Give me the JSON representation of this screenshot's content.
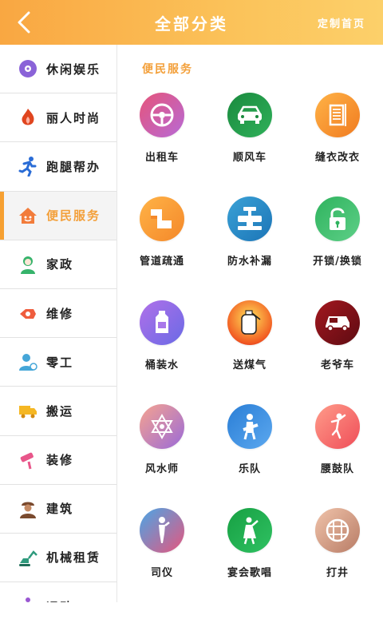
{
  "header": {
    "title": "全部分类",
    "right_link": "定制首页"
  },
  "sidebar": {
    "items": [
      {
        "label": "休闲娱乐",
        "icon": "music-disc-icon",
        "color": "#7b5bd6"
      },
      {
        "label": "丽人时尚",
        "icon": "flame-icon",
        "color": "#e0451f"
      },
      {
        "label": "跑腿帮办",
        "icon": "runner-icon",
        "color": "#2a6cd6"
      },
      {
        "label": "便民服务",
        "icon": "house-icon",
        "color": "#f27c3b"
      },
      {
        "label": "家政",
        "icon": "housekeeper-icon",
        "color": "#36b36b"
      },
      {
        "label": "维修",
        "icon": "repair-icon",
        "color": "#ef5d3e"
      },
      {
        "label": "零工",
        "icon": "worker-icon",
        "color": "#45a6d8"
      },
      {
        "label": "搬运",
        "icon": "truck-icon",
        "color": "#f5b723"
      },
      {
        "label": "装修",
        "icon": "paint-roller-icon",
        "color": "#e8568a"
      },
      {
        "label": "建筑",
        "icon": "builder-icon",
        "color": "#7a4a2e"
      },
      {
        "label": "机械租赁",
        "icon": "excavator-icon",
        "color": "#2f9a7d"
      },
      {
        "label": "运动",
        "icon": "sport-icon",
        "color": "#9a57d2"
      }
    ]
  },
  "main": {
    "section_title": "便民服务",
    "items": [
      {
        "label": "出租车",
        "icon": "steering-wheel-icon",
        "grad": [
          "#e6547a",
          "#b76ad6"
        ]
      },
      {
        "label": "顺风车",
        "icon": "car-icon",
        "grad": [
          "#1a8a3e",
          "#2fb05a"
        ]
      },
      {
        "label": "缝衣改衣",
        "icon": "sewing-icon",
        "grad": [
          "#ffb347",
          "#f07b20"
        ]
      },
      {
        "label": "管道疏通",
        "icon": "pipe-icon",
        "grad": [
          "#ffb347",
          "#f4882a"
        ]
      },
      {
        "label": "防水补漏",
        "icon": "valve-icon",
        "grad": [
          "#3aa1d6",
          "#1c75b7"
        ]
      },
      {
        "label": "开锁/换锁",
        "icon": "lock-icon",
        "grad": [
          "#2fb35e",
          "#5dcf87"
        ]
      },
      {
        "label": "桶装水",
        "icon": "water-bottle-icon",
        "grad": [
          "#b070e8",
          "#6a6ae6"
        ]
      },
      {
        "label": "送煤气",
        "icon": "gas-tank-icon",
        "grad": [
          "#ffd04a",
          "#e8311e"
        ]
      },
      {
        "label": "老爷车",
        "icon": "vintage-car-icon",
        "grad": [
          "#a3181f",
          "#5e0b12"
        ]
      },
      {
        "label": "风水师",
        "icon": "fengshui-icon",
        "grad": [
          "#f19c8c",
          "#9a6ad8"
        ]
      },
      {
        "label": "乐队",
        "icon": "band-icon",
        "grad": [
          "#2a7ed6",
          "#5ca8ef"
        ]
      },
      {
        "label": "腰鼓队",
        "icon": "drum-dancer-icon",
        "grad": [
          "#ff9c8a",
          "#ef4d58"
        ]
      },
      {
        "label": "司仪",
        "icon": "mc-icon",
        "grad": [
          "#4aa6e6",
          "#e6567e"
        ]
      },
      {
        "label": "宴会歌唱",
        "icon": "singer-icon",
        "grad": [
          "#17a043",
          "#2fc162"
        ]
      },
      {
        "label": "打井",
        "icon": "well-icon",
        "grad": [
          "#f0c3aa",
          "#b87c66"
        ]
      }
    ]
  }
}
